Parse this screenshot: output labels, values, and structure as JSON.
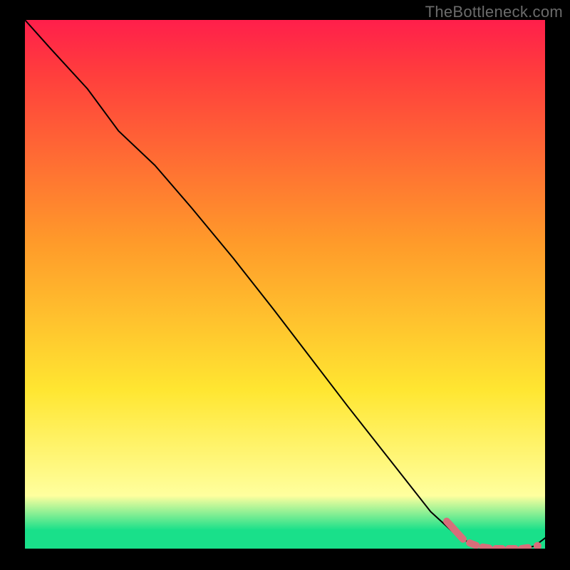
{
  "watermark": "TheBottleneck.com",
  "colors": {
    "gradient_top": "#ff1f4b",
    "gradient_mid_red": "#ff3d3d",
    "gradient_orange": "#ff9a2a",
    "gradient_yellow": "#ffe631",
    "gradient_pale_yellow": "#ffff9e",
    "gradient_green": "#19e08a",
    "curve": "#000000",
    "marker": "#d86e7a",
    "frame": "#000000"
  },
  "chart_data": {
    "type": "line",
    "title": "",
    "xlabel": "",
    "ylabel": "",
    "x": [
      0,
      5,
      12,
      18,
      25,
      32,
      40,
      48,
      55,
      62,
      70,
      78,
      83,
      86,
      88,
      90,
      92,
      94,
      96,
      98,
      100
    ],
    "values": [
      100,
      94.5,
      87,
      79,
      72.5,
      64.5,
      55,
      45,
      36,
      27,
      17,
      7,
      2.5,
      0.8,
      0.3,
      0,
      0,
      0,
      0,
      0.5,
      2
    ],
    "xlim": [
      0,
      100
    ],
    "ylim": [
      0,
      100
    ],
    "annotations": {
      "highlighted_x_range": [
        83,
        98
      ],
      "highlighted_meaning": "optimal / non-bottleneck zone (dashed pink segment hugging y≈0)"
    }
  },
  "gradient_stops": [
    {
      "offset": 0.0,
      "key": "gradient_top"
    },
    {
      "offset": 0.1,
      "key": "gradient_mid_red"
    },
    {
      "offset": 0.42,
      "key": "gradient_orange"
    },
    {
      "offset": 0.7,
      "key": "gradient_yellow"
    },
    {
      "offset": 0.9,
      "key": "gradient_pale_yellow"
    },
    {
      "offset": 0.965,
      "key": "gradient_green"
    },
    {
      "offset": 1.0,
      "key": "gradient_green"
    }
  ]
}
